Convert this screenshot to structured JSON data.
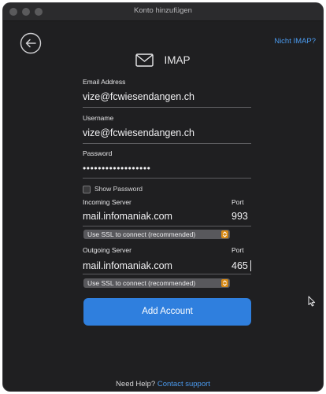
{
  "window": {
    "title": "Konto hinzufügen"
  },
  "header": {
    "not_imap": "Nicht IMAP?",
    "account_type": "IMAP"
  },
  "form": {
    "email_label": "Email Address",
    "email_value": "vize@fcwiesendangen.ch",
    "username_label": "Username",
    "username_value": "vize@fcwiesendangen.ch",
    "password_label": "Password",
    "password_masked": "••••••••••••••••••",
    "show_password_label": "Show Password",
    "show_password_checked": false,
    "incoming_label": "Incoming Server",
    "incoming_value": "mail.infomaniak.com",
    "incoming_port_label": "Port",
    "incoming_port": "993",
    "incoming_ssl": "Use SSL to connect (recommended)",
    "outgoing_label": "Outgoing Server",
    "outgoing_value": "mail.infomaniak.com",
    "outgoing_port_label": "Port",
    "outgoing_port": "465",
    "outgoing_ssl": "Use SSL to connect (recommended)",
    "add_account": "Add Account"
  },
  "footer": {
    "need_help": "Need Help?",
    "contact_support": "Contact support"
  },
  "colors": {
    "background": "#1f1f21",
    "accent": "#2f7fde",
    "link": "#4b9bf0",
    "dropdown_arrow": "#d88a16"
  },
  "icons": {
    "back": "arrow-left-circle-icon",
    "mail": "envelope-icon",
    "cursor": "mouse-pointer-icon"
  }
}
